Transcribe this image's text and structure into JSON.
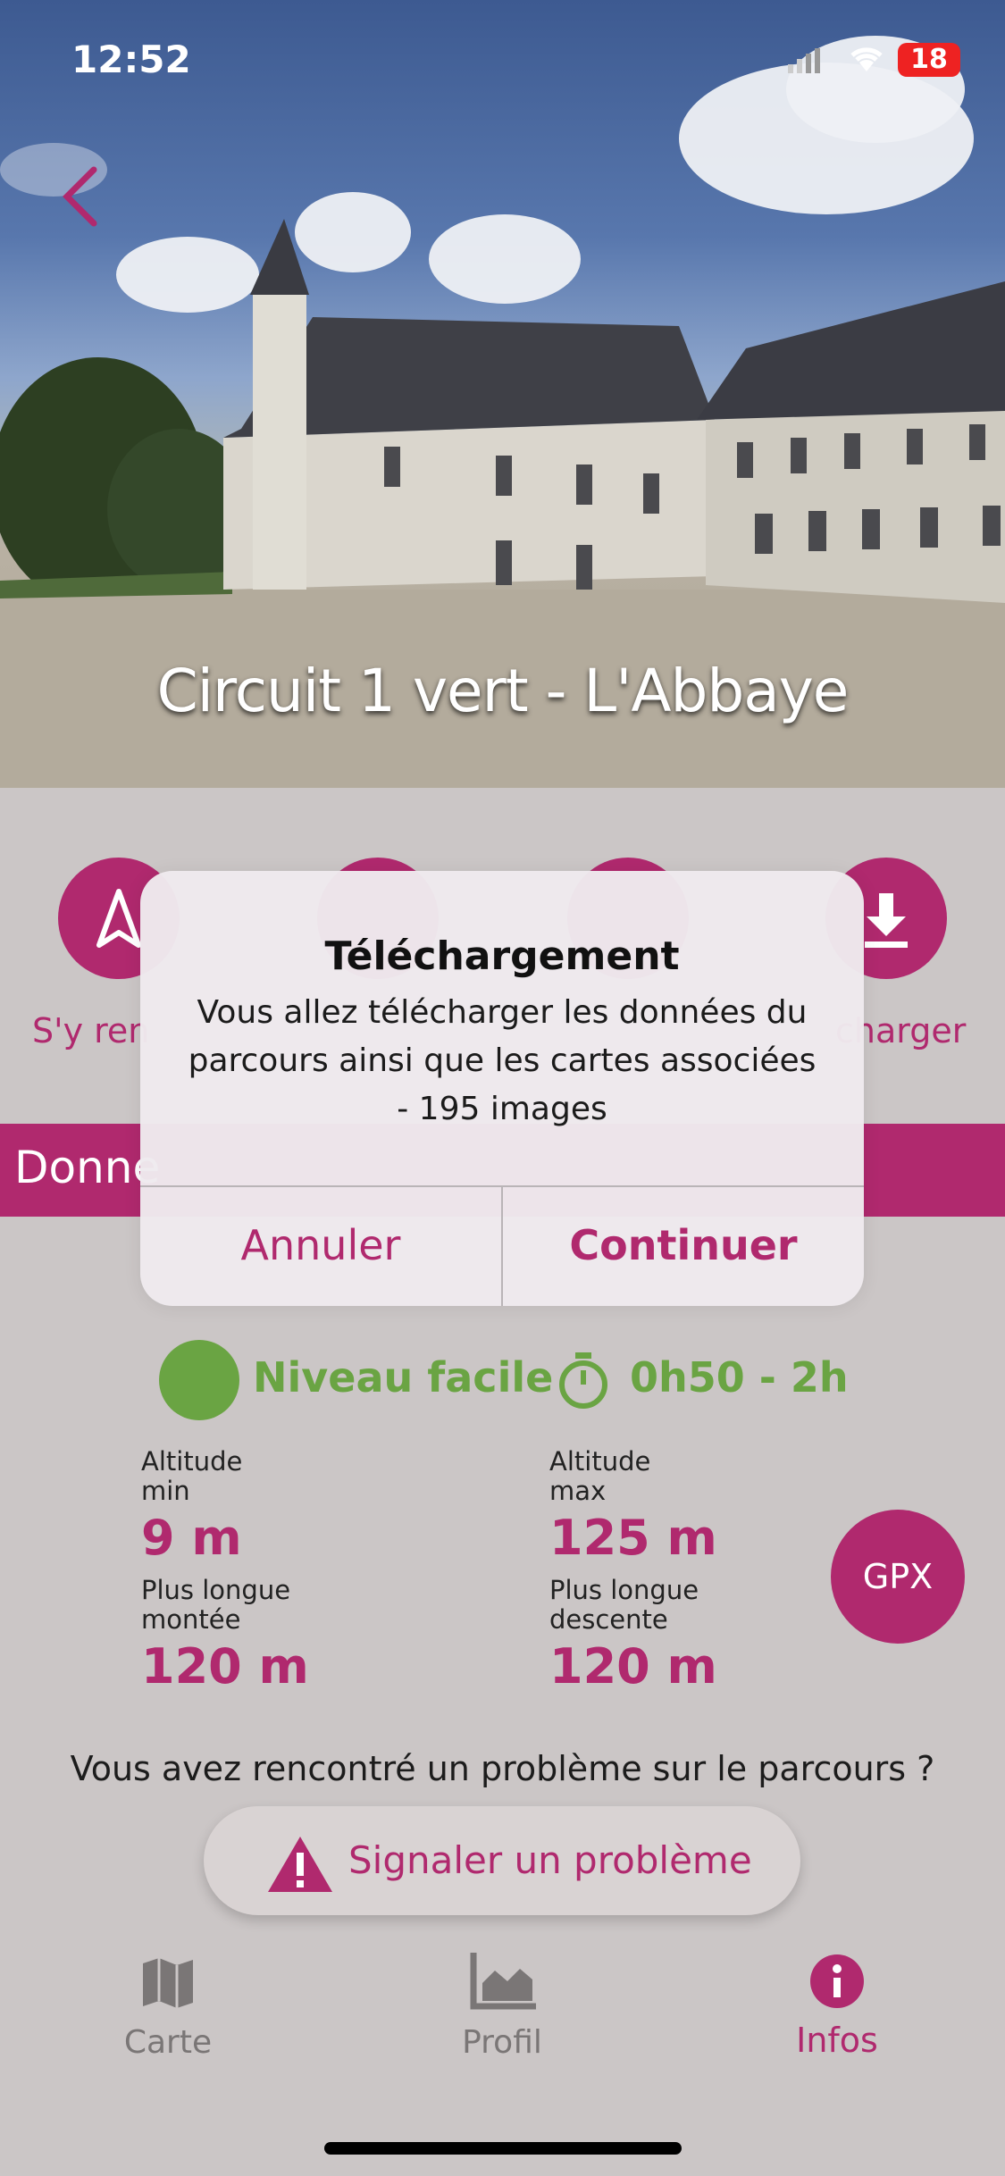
{
  "status_bar": {
    "time": "12:52",
    "battery": "18"
  },
  "hero": {
    "title": "Circuit 1 vert - L'Abbaye"
  },
  "actions": [
    {
      "label": "S'y ren"
    },
    {
      "label": "charger"
    }
  ],
  "section": {
    "title": "Donne"
  },
  "difficulty": {
    "level": "Niveau facile",
    "duration": "0h50 - 2h"
  },
  "stats": {
    "alt_min_label_1": "Altitude",
    "alt_min_label_2": "min",
    "alt_min_value": "9 m",
    "alt_max_label_1": "Altitude",
    "alt_max_label_2": "max",
    "alt_max_value": "125 m",
    "climb_label_1": "Plus longue",
    "climb_label_2": "montée",
    "climb_value": "120 m",
    "descent_label_1": "Plus longue",
    "descent_label_2": "descente",
    "descent_value": "120 m"
  },
  "gpx_label": "GPX",
  "problem": {
    "question": "Vous avez rencontré un problème sur le parcours ?",
    "button": "Signaler un problème"
  },
  "tabs": [
    {
      "label": "Carte",
      "icon": "map-icon"
    },
    {
      "label": "Profil",
      "icon": "elevation-chart-icon"
    },
    {
      "label": "Infos",
      "icon": "info-icon",
      "active": true
    }
  ],
  "dialog": {
    "title": "Téléchargement",
    "message": "Vous allez télécharger les données du parcours ainsi que les cartes associées - 195 images",
    "cancel": "Annuler",
    "confirm": "Continuer"
  },
  "colors": {
    "accent": "#b0296e",
    "green": "#6aa443",
    "background": "#cbc6c6"
  }
}
